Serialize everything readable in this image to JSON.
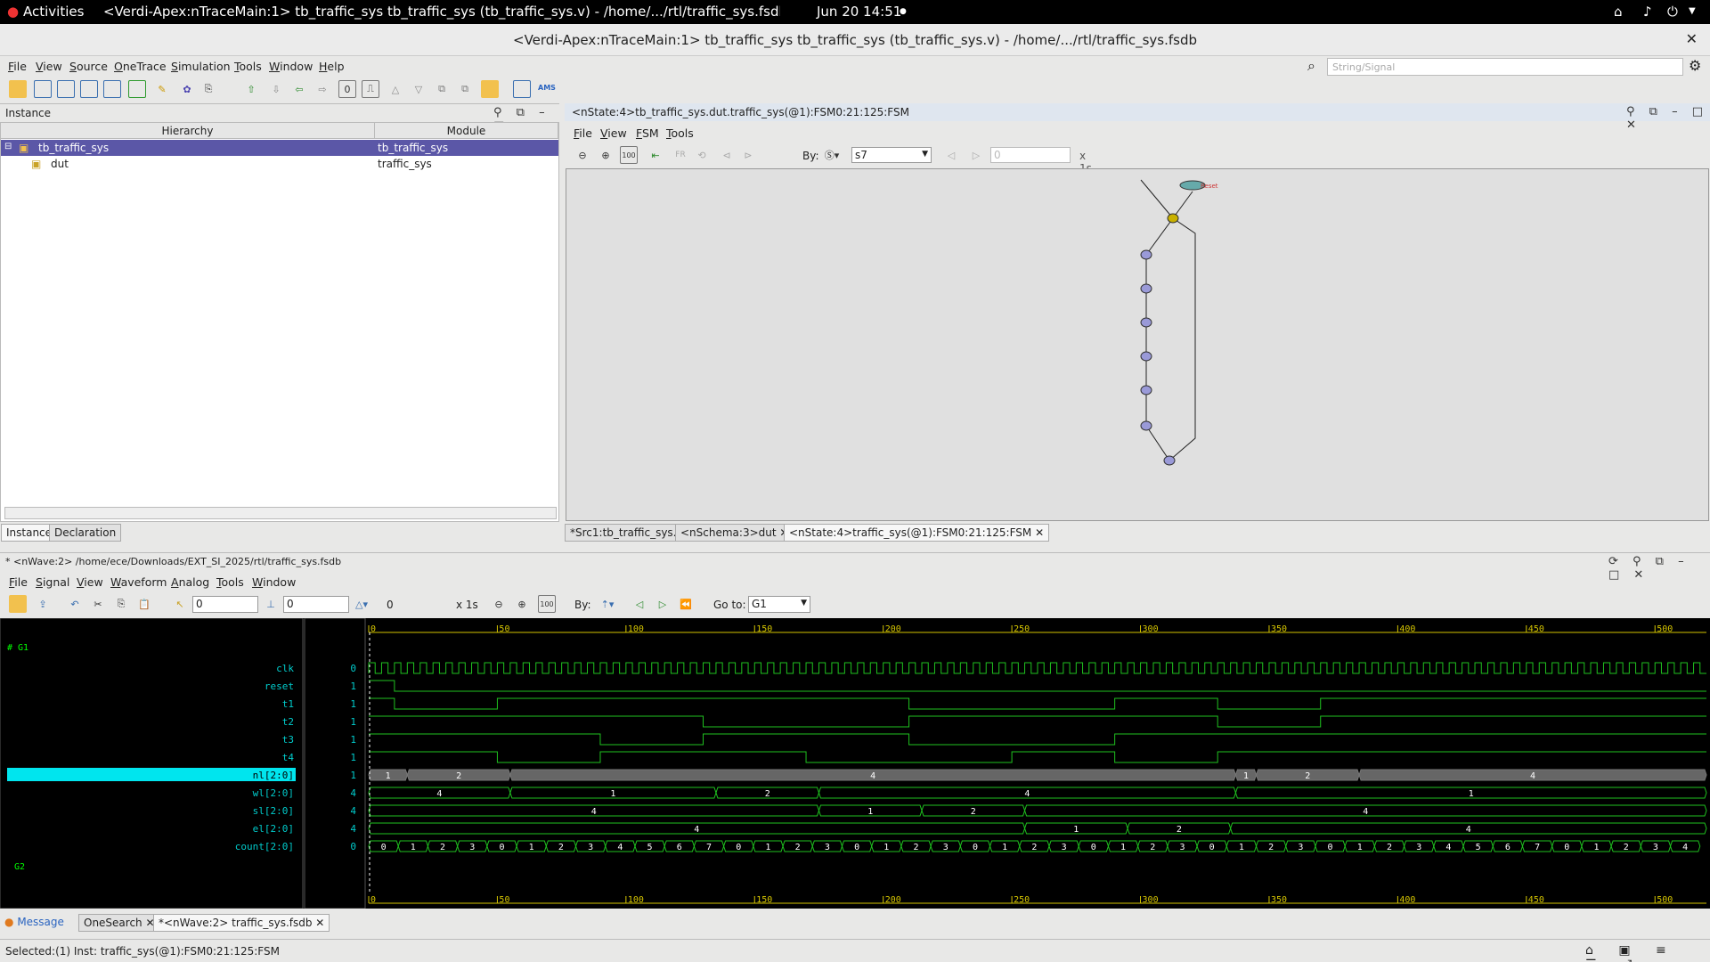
{
  "gnome": {
    "activities": "Activities",
    "app_title": "<Verdi-Apex:nTraceMain:1> tb_traffic_sys tb_traffic_sys (tb_traffic_sys.v) - /home/.../rtl/traffic_sys.fsdb",
    "clock": "Jun 20  14:51"
  },
  "window": {
    "title": "<Verdi-Apex:nTraceMain:1> tb_traffic_sys tb_traffic_sys (tb_traffic_sys.v) - /home/.../rtl/traffic_sys.fsdb"
  },
  "main_menu": [
    "File",
    "View",
    "Source",
    "OneTrace",
    "Simulation",
    "Tools",
    "Window",
    "Help"
  ],
  "search": {
    "placeholder": "String/Signal"
  },
  "instance_panel": {
    "title": "Instance",
    "col_hierarchy": "Hierarchy",
    "col_module": "Module",
    "rows": [
      {
        "name": "tb_traffic_sys",
        "module": "tb_traffic_sys"
      },
      {
        "name": "dut",
        "module": "traffic_sys"
      }
    ],
    "tabs": [
      "Instance",
      "Declaration"
    ]
  },
  "fsm_panel": {
    "title": "<nState:4>tb_traffic_sys.dut.traffic_sys(@1):FSM0:21:125:FSM",
    "menu": [
      "File",
      "View",
      "FSM",
      "Tools"
    ],
    "by_label": "By:",
    "state_select": "s7",
    "step_value": "0",
    "scale": "x 1s",
    "state_label_top": "Reset"
  },
  "editor_tabs": [
    "*Src1:tb_traffic_sys.v",
    "<nSchema:3>dut",
    "<nState:4>traffic_sys(@1):FSM0:21:125:FSM"
  ],
  "wave_panel": {
    "title": "* <nWave:2> /home/ece/Downloads/EXT_SI_2025/rtl/traffic_sys.fsdb",
    "menu": [
      "File",
      "Signal",
      "View",
      "Waveform",
      "Analog",
      "Tools",
      "Window"
    ],
    "cursor_a": "0",
    "cursor_b": "0",
    "delta": "0",
    "scale": "x 1s",
    "by_label": "By:",
    "goto_label": "Go to:",
    "goto_value": "G1",
    "groups": [
      "G1",
      "G2"
    ],
    "signals": [
      {
        "name": "clk",
        "value": "0"
      },
      {
        "name": "reset",
        "value": "1"
      },
      {
        "name": "t1",
        "value": "1"
      },
      {
        "name": "t2",
        "value": "1"
      },
      {
        "name": "t3",
        "value": "1"
      },
      {
        "name": "t4",
        "value": "1"
      },
      {
        "name": "nl[2:0]",
        "value": "1"
      },
      {
        "name": "wl[2:0]",
        "value": "4"
      },
      {
        "name": "sl[2:0]",
        "value": "4"
      },
      {
        "name": "el[2:0]",
        "value": "4"
      },
      {
        "name": "count[2:0]",
        "value": "0"
      }
    ],
    "ruler_ticks": [
      "0",
      "50",
      "100",
      "150",
      "200",
      "250",
      "300",
      "350",
      "400",
      "450",
      "500"
    ],
    "bus_nl": [
      "1",
      "2",
      "4",
      "1",
      "2",
      "4"
    ],
    "bus_wl": [
      "4",
      "1",
      "2",
      "4",
      "1"
    ],
    "bus_sl": [
      "4",
      "1",
      "2",
      "4"
    ],
    "bus_el": [
      "4",
      "1",
      "2",
      "4"
    ],
    "bus_count": [
      "0",
      "1",
      "2",
      "3",
      "0",
      "1",
      "2",
      "3",
      "4",
      "5",
      "6",
      "7",
      "0",
      "1",
      "2",
      "3",
      "0",
      "1",
      "2",
      "3",
      "0",
      "1",
      "2",
      "3",
      "0",
      "1",
      "2",
      "3",
      "0",
      "1",
      "2",
      "3",
      "0",
      "1",
      "2",
      "3",
      "4",
      "5",
      "6",
      "7",
      "0",
      "1",
      "2",
      "3",
      "4"
    ]
  },
  "bottom_tabs": [
    "Message",
    "OneSearch",
    "*<nWave:2> traffic_sys.fsdb"
  ],
  "status": "Selected:(1) Inst: traffic_sys(@1):FSM0:21:125:FSM",
  "colors": {
    "selection": "#5b57a7",
    "wave_green": "#1fc21f",
    "wave_cyan": "#00c8c8",
    "highlight": "#00e5ee",
    "ruler": "#d4c400"
  }
}
